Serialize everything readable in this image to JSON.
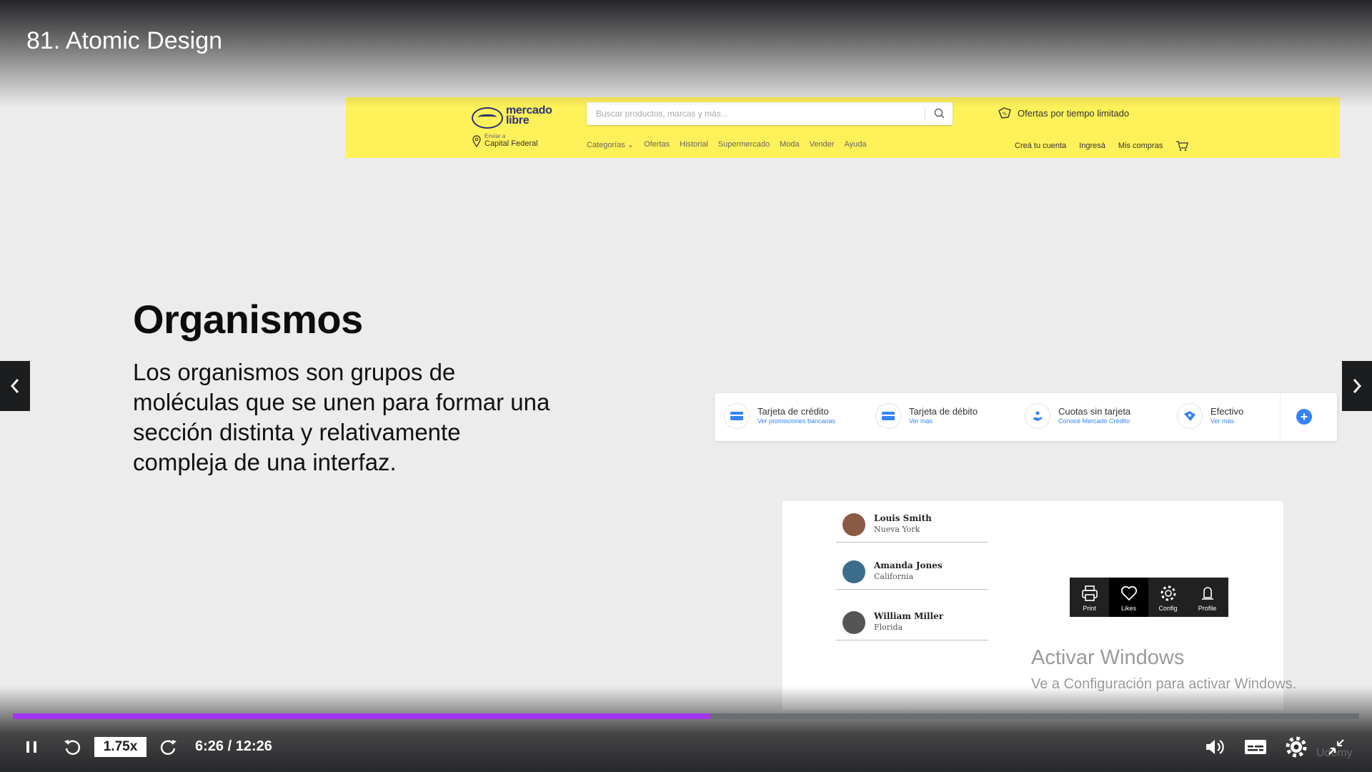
{
  "lecture": {
    "title": "81. Atomic Design"
  },
  "slide": {
    "heading": "Organismos",
    "body": "Los organismos son grupos de moléculas que se unen para formar una sección distinta y relativamente compleja de una interfaz."
  },
  "ml_header": {
    "logo_text_1": "mercado",
    "logo_text_2": "libre",
    "search_placeholder": "Buscar productos, marcas y más...",
    "promo": "Ofertas por tiempo limitado",
    "location_label": "Enviar a",
    "location_value": "Capital Federal",
    "nav": [
      "Categorías ⌄",
      "Ofertas",
      "Historial",
      "Supermercado",
      "Moda",
      "Vender",
      "Ayuda"
    ],
    "user": [
      "Creá tu cuenta",
      "Ingresá",
      "Mis compras"
    ],
    "color": "#fff159"
  },
  "payments": [
    {
      "title": "Tarjeta de crédito",
      "sub": "Ver promociones bancarias"
    },
    {
      "title": "Tarjeta de débito",
      "sub": "Ver más"
    },
    {
      "title": "Cuotas sin tarjeta",
      "sub": "Conocé Mercado Crédito"
    },
    {
      "title": "Efectivo",
      "sub": "Ver más"
    }
  ],
  "people": [
    {
      "name": "Louis Smith",
      "city": "Nueva York",
      "avatar_color": "#8a5a44"
    },
    {
      "name": "Amanda Jones",
      "city": "California",
      "avatar_color": "#3a6d8c"
    },
    {
      "name": "William Miller",
      "city": "Florida",
      "avatar_color": "#555555"
    }
  ],
  "toolbar": [
    {
      "label": "Print",
      "icon": "printer-icon",
      "active": false
    },
    {
      "label": "Likes",
      "icon": "heart-icon",
      "active": true
    },
    {
      "label": "Config",
      "icon": "gear-icon",
      "active": false
    },
    {
      "label": "Profile",
      "icon": "user-icon",
      "active": false
    }
  ],
  "watermark": {
    "title": "Activar Windows",
    "sub": "Ve a Configuración para activar Windows."
  },
  "player": {
    "speed": "1.75x",
    "time": "6:26 / 12:26",
    "progress_fraction": 0.518,
    "accent": "#a435f0",
    "brand_mark": "Udemy"
  }
}
